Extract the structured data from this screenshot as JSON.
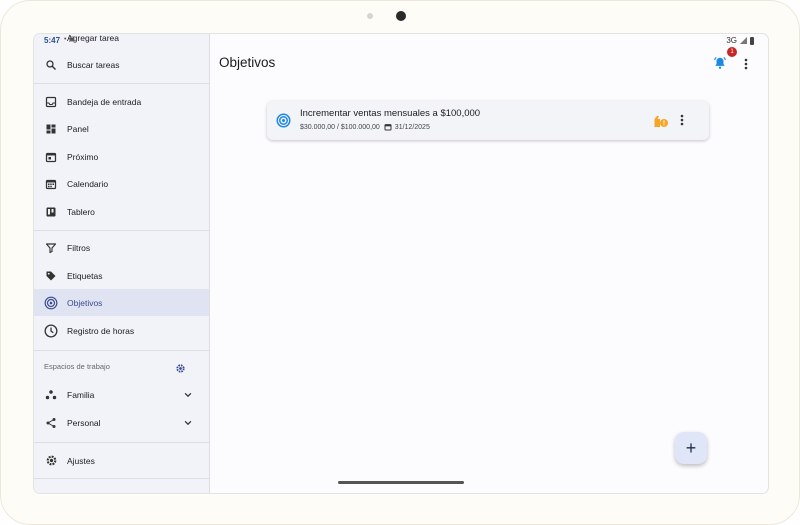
{
  "status_bar": {
    "time": "5:47",
    "network": "3G"
  },
  "sidebar": {
    "top_items": [
      {
        "label": "Agregar tarea",
        "icon": "add-icon"
      },
      {
        "label": "Buscar tareas",
        "icon": "search-icon"
      }
    ],
    "main_items": [
      {
        "label": "Bandeja de entrada",
        "icon": "inbox-icon"
      },
      {
        "label": "Panel",
        "icon": "dashboard-icon"
      },
      {
        "label": "Próximo",
        "icon": "calendar-today-icon"
      },
      {
        "label": "Calendario",
        "icon": "calendar-month-icon"
      },
      {
        "label": "Tablero",
        "icon": "board-icon"
      }
    ],
    "secondary_items": [
      {
        "label": "Filtros",
        "icon": "filter-icon"
      },
      {
        "label": "Etiquetas",
        "icon": "tag-icon"
      },
      {
        "label": "Objetivos",
        "icon": "target-icon",
        "active": true
      },
      {
        "label": "Registro de horas",
        "icon": "clock-icon"
      }
    ],
    "workspaces_title": "Espacios de trabajo",
    "workspaces": [
      {
        "label": "Familia",
        "icon": "group-icon"
      },
      {
        "label": "Personal",
        "icon": "share-icon"
      }
    ],
    "settings_label": "Ajustes"
  },
  "header": {
    "title": "Objetivos",
    "notification_count": "1"
  },
  "goal_card": {
    "title": "Incrementar ventas mensuales a $100,000",
    "progress_text": "$30.000,00 / $100.000,00",
    "due_date": "31/12/2025",
    "progress_fraction": 0.3
  },
  "fab_label": "+",
  "colors": {
    "accent": "#3a4c8f",
    "active_bg": "#e0e3f2",
    "target_blue": "#1e88e5",
    "warning": "#f5a623",
    "badge": "#c62828"
  }
}
